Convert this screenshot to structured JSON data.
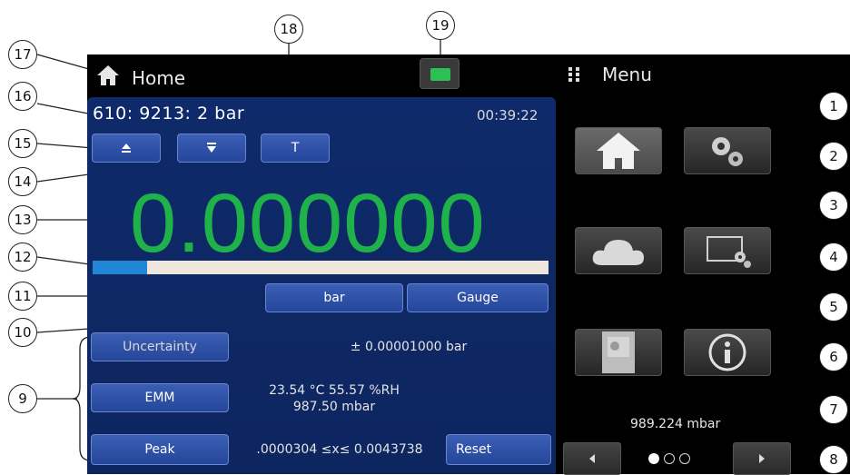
{
  "header": {
    "home_title": "Home",
    "menu_title": "Menu"
  },
  "channel": {
    "label": "610: 9213:  2 bar",
    "clock": "00:39:22"
  },
  "controls": {
    "tare_label": "T"
  },
  "reading": {
    "value": "0.000000",
    "bar_fraction": 0.12
  },
  "unit_buttons": {
    "unit": "bar",
    "mode": "Gauge"
  },
  "rows": {
    "uncertainty_label": "Uncertainty",
    "uncertainty_value": "± 0.00001000   bar",
    "emm_label": "EMM",
    "emm_line1": "23.54 °C   55.57 %RH",
    "emm_line2": "987.50 mbar",
    "peak_label": "Peak",
    "peak_value": ".0000304 ≤x≤ 0.0043738",
    "reset_label": "Reset"
  },
  "menu": {
    "barometer": "989.224 mbar",
    "page_indicator": {
      "current": 1,
      "total": 3
    }
  },
  "callouts": [
    "1",
    "2",
    "3",
    "4",
    "5",
    "6",
    "7",
    "8",
    "9",
    "10",
    "11",
    "12",
    "13",
    "14",
    "15",
    "16",
    "17",
    "18",
    "19"
  ],
  "colors": {
    "panel_blue": "#0f2a6a",
    "reading_green": "#1fb24a",
    "bar_blue": "#2286d6",
    "status_green": "#2bbf55"
  },
  "icons": {
    "home": "home-icon",
    "settings": "gears-icon",
    "cloud": "cloud-icon",
    "display_settings": "display-settings-icon",
    "storage": "document-storage-icon",
    "info": "info-icon",
    "remote": "remote-connection-icon",
    "zero": "zero-icon",
    "auto_zero": "auto-zero-icon"
  }
}
